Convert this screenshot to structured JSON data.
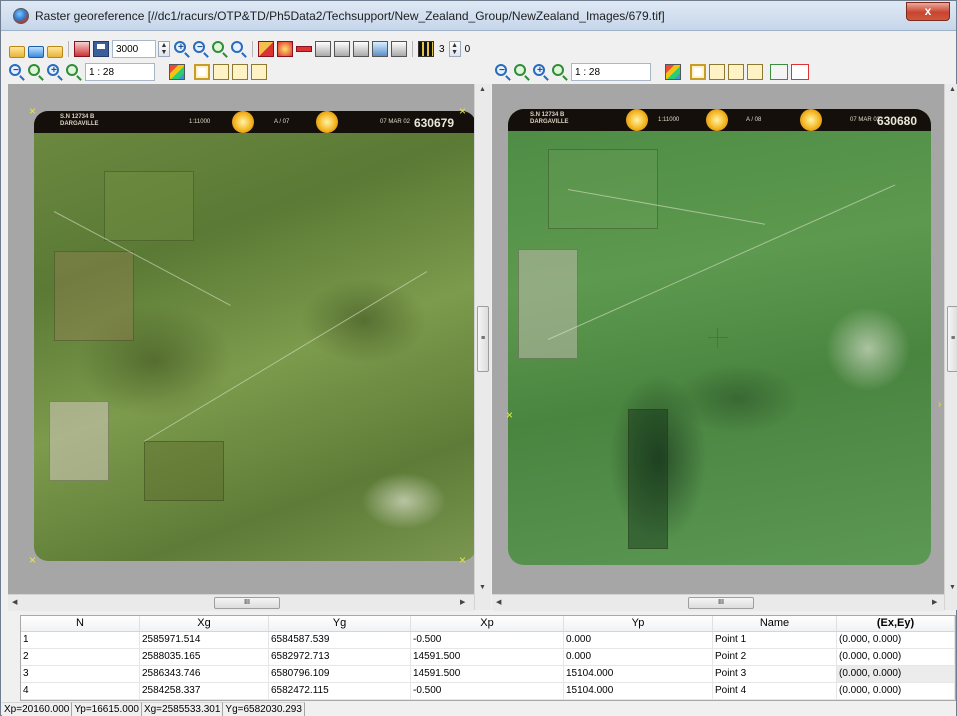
{
  "window": {
    "title": "Raster georeference [//dc1/racurs/OTP&TD/Ph5Data2/Techsupport/New_Zealand_Group/NewZealand_Images/679.tif]",
    "close_label": "x"
  },
  "toolbar": {
    "scale_value": "3000",
    "band_value": "3",
    "band_second": "0"
  },
  "left_view": {
    "zoom_value": "1 : 28",
    "photo": {
      "frame_info": "S.N 12734 B\nDARGAVILLE",
      "scale_text": "1:11000",
      "run_text": "A / 07",
      "date_text": "07 MAR 02",
      "frame_number": "630679"
    }
  },
  "right_view": {
    "zoom_value": "1 : 28",
    "photo": {
      "frame_info": "S.N 12734 B\nDARGAVILLE",
      "scale_text": "1:11000",
      "run_text": "A / 08",
      "date_text": "07 MAR 02",
      "frame_number": "630680"
    }
  },
  "scroll": {
    "thumb_label": "III",
    "v_thumb_label": "≡"
  },
  "table": {
    "columns": [
      "N",
      "Xg",
      "Yg",
      "Xp",
      "Yp",
      "Name",
      "(Ex,Ey)"
    ],
    "rows": [
      [
        "1",
        "2585971.514",
        "6584587.539",
        "-0.500",
        "0.000",
        "Point 1",
        "(0.000, 0.000)"
      ],
      [
        "2",
        "2588035.165",
        "6582972.713",
        "14591.500",
        "0.000",
        "Point 2",
        "(0.000, 0.000)"
      ],
      [
        "3",
        "2586343.746",
        "6580796.109",
        "14591.500",
        "15104.000",
        "Point 3",
        "(0.000, 0.000)"
      ],
      [
        "4",
        "2584258.337",
        "6582472.115",
        "-0.500",
        "15104.000",
        "Point 4",
        "(0.000, 0.000)"
      ]
    ]
  },
  "status": {
    "xp": "Xp=20160.000",
    "yp": "Yp=16615.000",
    "xg": "Xg=2585533.301",
    "yg": "Yg=6582030.293"
  },
  "icons": {
    "open": "folder-open-icon",
    "save": "save-icon",
    "zoom_in": "zoom-in-icon",
    "zoom_out": "zoom-out-icon",
    "color": "color-icon"
  }
}
